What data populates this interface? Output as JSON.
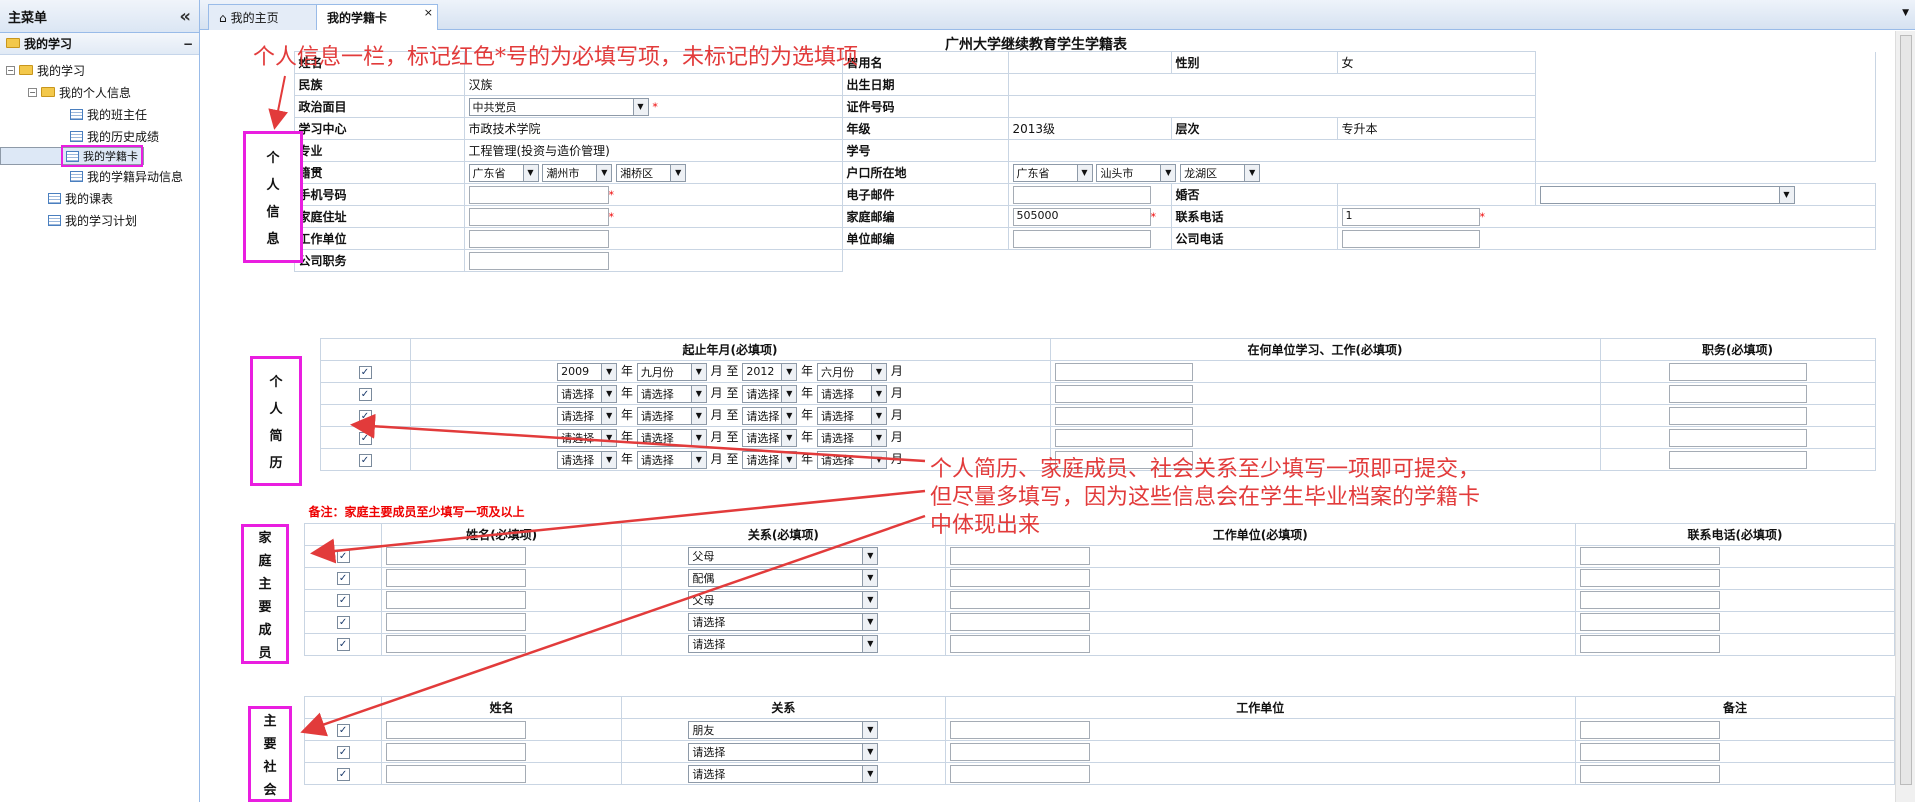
{
  "sidebar": {
    "title": "主菜单",
    "collapse": "«",
    "section": "我的学习",
    "section_collapse": "−",
    "items": [
      "我的学习",
      "我的个人信息",
      "我的班主任",
      "我的历史成绩",
      "我的学籍卡",
      "我的学籍异动信息",
      "我的课表",
      "我的学习计划"
    ]
  },
  "tabs": {
    "home": "我的主页",
    "current": "我的学籍卡",
    "close": "×"
  },
  "page_title": "广州大学继续教育学生学籍表",
  "personal": {
    "name": "姓名",
    "former": "曾用名",
    "gender": "性别",
    "gender_v": "女",
    "nation": "民族",
    "nation_v": "汉族",
    "birth": "出生日期",
    "politics": "政治面目",
    "politics_v": "中共党员",
    "idno": "证件号码",
    "center": "学习中心",
    "center_v": "市政技术学院",
    "grade": "年级",
    "grade_v": "2013级",
    "level": "层次",
    "level_v": "专升本",
    "major": "专业",
    "major_v": "工程管理(投资与造价管理)",
    "stuno": "学号",
    "origin": "籍贯",
    "o1": "广东省",
    "o2": "潮州市",
    "o3": "湘桥区",
    "hukou": "户口所在地",
    "h1": "广东省",
    "h2": "汕头市",
    "h3": "龙湖区",
    "phone": "手机号码",
    "email": "电子邮件",
    "married": "婚否",
    "address": "家庭住址",
    "zip": "家庭邮编",
    "zip_v": "505000",
    "tel": "联系电话",
    "tel_v": "1",
    "work": "工作单位",
    "wzip": "单位邮编",
    "wtel": "公司电话",
    "duty": "公司职务"
  },
  "resume": {
    "col1": "起止年月(必填项)",
    "col2": "在何单位学习、工作(必填项)",
    "col3": "职务(必填项)",
    "year": "年",
    "month": "月",
    "to": "至",
    "choose": "请选择",
    "row1": {
      "y1": "2009",
      "m1": "九月份",
      "y2": "2012",
      "m2": "六月份"
    }
  },
  "family": {
    "note": "备注：家庭主要成员至少填写一项及以上",
    "col1": "姓名(必填项)",
    "col2": "关系(必填项)",
    "col3": "工作单位(必填项)",
    "col4": "联系电话(必填项)",
    "rel": [
      "父母",
      "配偶",
      "父母",
      "请选择",
      "请选择"
    ]
  },
  "social": {
    "col1": "姓名",
    "col2": "关系",
    "col3": "工作单位",
    "col4": "备注",
    "rel": [
      "朋友",
      "请选择",
      "请选择"
    ]
  },
  "labels": {
    "personal": [
      "个",
      "人",
      "信",
      "息"
    ],
    "resume": [
      "个",
      "人",
      "简",
      "历"
    ],
    "family": [
      "家",
      "庭",
      "主",
      "要",
      "成",
      "员"
    ],
    "social": [
      "主",
      "要",
      "社",
      "会"
    ]
  },
  "annotations": {
    "a1": "个人信息一栏，标记红色*号的为必填写项，未标记的为选填项",
    "a2": "个人简历、家庭成员、社会关系至少填写一项即可提交，",
    "a3": "但尽量多填写，因为这些信息会在学生毕业档案的学籍卡",
    "a4": "中体现出来"
  }
}
